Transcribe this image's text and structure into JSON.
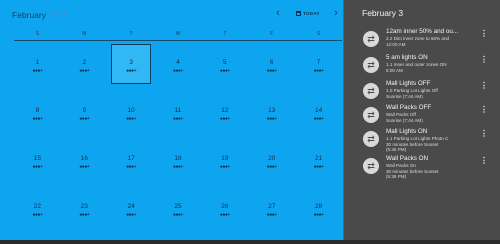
{
  "calendar": {
    "month": "February",
    "year": "2026",
    "prev_arrow": "‹",
    "next_arrow": "›",
    "today_label": "TODAY",
    "weekdays": [
      "S",
      "M",
      "T",
      "W",
      "T",
      "F",
      "S"
    ],
    "dots": "●●●+",
    "weeks": [
      [
        "1",
        "2",
        "3",
        "4",
        "5",
        "6",
        "7"
      ],
      [
        "8",
        "9",
        "10",
        "11",
        "12",
        "13",
        "14"
      ],
      [
        "15",
        "16",
        "17",
        "18",
        "19",
        "20",
        "21"
      ],
      [
        "22",
        "23",
        "24",
        "25",
        "26",
        "27",
        "28"
      ]
    ],
    "selected_day": "3"
  },
  "events": {
    "title": "February 3",
    "icon": "repeat-icon",
    "items": [
      {
        "title": "12am inner 50% and ou...",
        "lines": [
          "2.2 Dim inner zone to 50% and",
          "12:00 AM"
        ]
      },
      {
        "title": "5 am lights ON",
        "lines": [
          "1.1 Inner and outer zones ON",
          "5:00 AM"
        ]
      },
      {
        "title": "Mall Lights OFF",
        "lines": [
          "1.0 Parking Lot Lights Off",
          "Sunrise (7:44 AM)"
        ]
      },
      {
        "title": "Wall Packs OFF",
        "lines": [
          "Wall Packs Off",
          "Sunrise (7:44 AM)"
        ]
      },
      {
        "title": "Mall Lights ON",
        "lines": [
          "1.1 Parking Lot Lights Photo C",
          "30 minutes before Sunset",
          "(5:36 PM)"
        ]
      },
      {
        "title": "Wall Packs ON",
        "lines": [
          "Wall Packs On",
          "30 minutes before Sunset",
          "(5:36 PM)"
        ]
      }
    ]
  }
}
